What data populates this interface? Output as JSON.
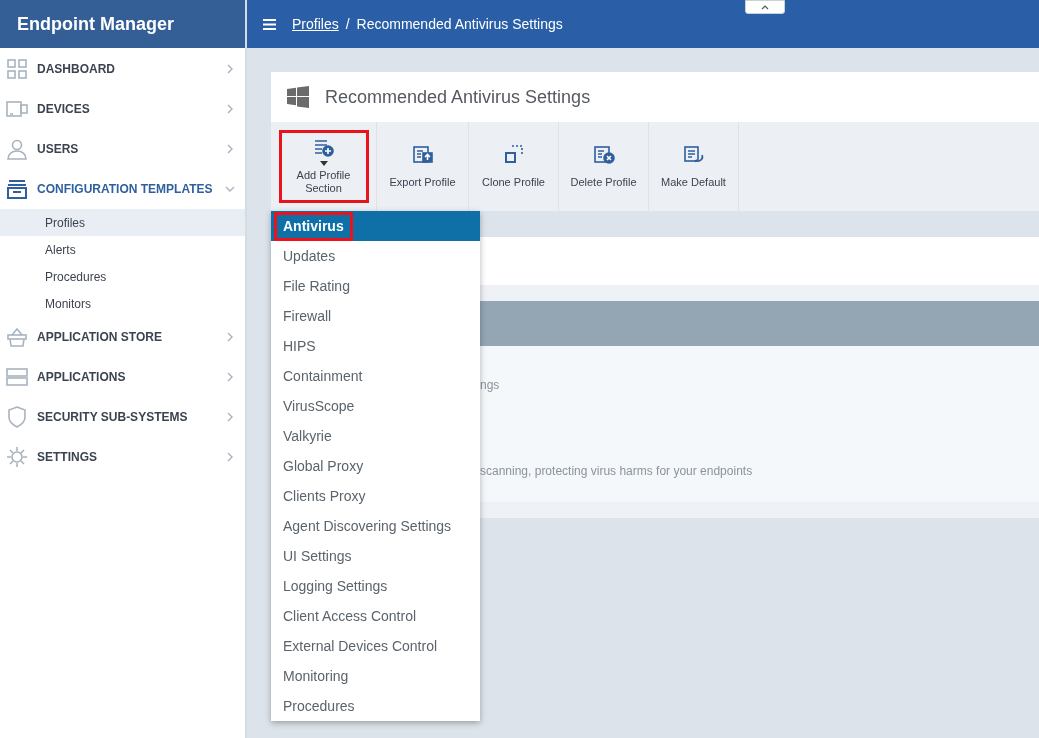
{
  "app": {
    "title": "Endpoint Manager"
  },
  "sidebar": {
    "items": [
      {
        "label": "DASHBOARD",
        "kind": "grid",
        "expanded": false,
        "active": false
      },
      {
        "label": "DEVICES",
        "kind": "devices",
        "expanded": false,
        "active": false
      },
      {
        "label": "USERS",
        "kind": "user",
        "expanded": false,
        "active": false
      },
      {
        "label": "CONFIGURATION TEMPLATES",
        "kind": "templates",
        "expanded": true,
        "active": true,
        "children": [
          {
            "label": "Profiles",
            "selected": true
          },
          {
            "label": "Alerts",
            "selected": false
          },
          {
            "label": "Procedures",
            "selected": false
          },
          {
            "label": "Monitors",
            "selected": false
          }
        ]
      },
      {
        "label": "APPLICATION STORE",
        "kind": "basket",
        "expanded": false,
        "active": false
      },
      {
        "label": "APPLICATIONS",
        "kind": "server",
        "expanded": false,
        "active": false
      },
      {
        "label": "SECURITY SUB-SYSTEMS",
        "kind": "shield",
        "expanded": false,
        "active": false
      },
      {
        "label": "SETTINGS",
        "kind": "gear",
        "expanded": false,
        "active": false
      }
    ]
  },
  "breadcrumb": {
    "items": [
      "Profiles",
      "Recommended Antivirus Settings"
    ],
    "separator": "/"
  },
  "profile": {
    "title": "Recommended Antivirus Settings"
  },
  "toolbar": {
    "buttons": [
      {
        "label": "Add Profile Section",
        "kind": "add",
        "highlighted": true,
        "has_menu": true
      },
      {
        "label": "Export Profile",
        "kind": "export",
        "highlighted": false,
        "has_menu": false
      },
      {
        "label": "Clone Profile",
        "kind": "clone",
        "highlighted": false,
        "has_menu": false
      },
      {
        "label": "Delete Profile",
        "kind": "delete",
        "highlighted": false,
        "has_menu": false
      },
      {
        "label": "Make Default",
        "kind": "default",
        "highlighted": false,
        "has_menu": false
      }
    ]
  },
  "dropdown": {
    "items": [
      {
        "label": "Antivirus",
        "selected": true,
        "highlighted": true
      },
      {
        "label": "Updates",
        "selected": false,
        "highlighted": false
      },
      {
        "label": "File Rating",
        "selected": false,
        "highlighted": false
      },
      {
        "label": "Firewall",
        "selected": false,
        "highlighted": false
      },
      {
        "label": "HIPS",
        "selected": false,
        "highlighted": false
      },
      {
        "label": "Containment",
        "selected": false,
        "highlighted": false
      },
      {
        "label": "VirusScope",
        "selected": false,
        "highlighted": false
      },
      {
        "label": "Valkyrie",
        "selected": false,
        "highlighted": false
      },
      {
        "label": "Global Proxy",
        "selected": false,
        "highlighted": false
      },
      {
        "label": "Clients Proxy",
        "selected": false,
        "highlighted": false
      },
      {
        "label": "Agent Discovering Settings",
        "selected": false,
        "highlighted": false
      },
      {
        "label": "UI Settings",
        "selected": false,
        "highlighted": false
      },
      {
        "label": "Logging Settings",
        "selected": false,
        "highlighted": false
      },
      {
        "label": "Client Access Control",
        "selected": false,
        "highlighted": false
      },
      {
        "label": "External Devices Control",
        "selected": false,
        "highlighted": false
      },
      {
        "label": "Monitoring",
        "selected": false,
        "highlighted": false
      },
      {
        "label": "Procedures",
        "selected": false,
        "highlighted": false
      }
    ]
  },
  "section": {
    "texts": [
      "ngs",
      "scanning, protecting virus harms for your endpoints"
    ]
  }
}
